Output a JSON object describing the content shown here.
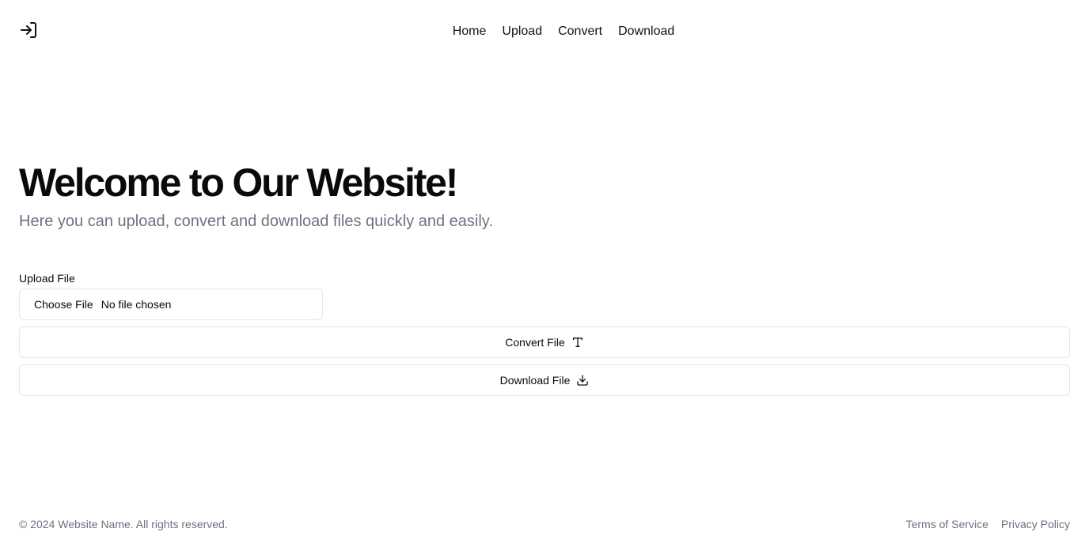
{
  "header": {
    "login_icon": "log-in-icon",
    "nav": [
      {
        "label": "Home"
      },
      {
        "label": "Upload"
      },
      {
        "label": "Convert"
      },
      {
        "label": "Download"
      }
    ]
  },
  "hero": {
    "title": "Welcome to Our Website!",
    "subtitle": "Here you can upload, convert and download files quickly and easily."
  },
  "upload": {
    "label": "Upload File",
    "choose_label": "Choose File",
    "status": "No file chosen"
  },
  "actions": {
    "convert_label": "Convert File",
    "convert_icon": "type-icon",
    "download_label": "Download File",
    "download_icon": "download-icon"
  },
  "footer": {
    "copyright": "© 2024 Website Name. All rights reserved.",
    "links": [
      {
        "label": "Terms of Service"
      },
      {
        "label": "Privacy Policy"
      }
    ]
  },
  "colors": {
    "text": "#0a0a0a",
    "muted": "#6b7280",
    "border": "#e5e7eb",
    "background": "#ffffff"
  }
}
